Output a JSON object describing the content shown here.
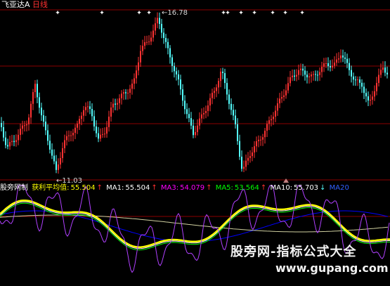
{
  "header": {
    "stock_name": "飞亚达A",
    "period": "日线"
  },
  "price_panel": {
    "high_label": "16.78",
    "low_label": "11.03",
    "signal_marker": "✦"
  },
  "indicator_bar": {
    "name": "股旁网制",
    "main_label": "获利平均值:",
    "main_value": "55.504",
    "ma1_label": "MA1:",
    "ma1_value": "55.504",
    "ma3_label": "MA3:",
    "ma3_value": "54.079",
    "ma5_label": "MA5:",
    "ma5_value": "53.564",
    "ma10_label": "MA10:",
    "ma10_value": "55.703",
    "ma20_label": "MA20",
    "arrow_up": "↑",
    "arrow_down": "↓"
  },
  "watermark": {
    "site_name": "股旁网-指标公式大全",
    "url": "www.gupang.com"
  },
  "colors": {
    "up_candle": "#ff3232",
    "down_candle": "#54ffff",
    "grid": "#8b0000",
    "main_line": "#ffff00",
    "ma1": "#ffffff",
    "ma3": "#ff00ff",
    "ma5": "#00ff00",
    "ma10": "#ffffff",
    "ma20": "#0000ff",
    "purple_line": "#b040ff"
  }
}
